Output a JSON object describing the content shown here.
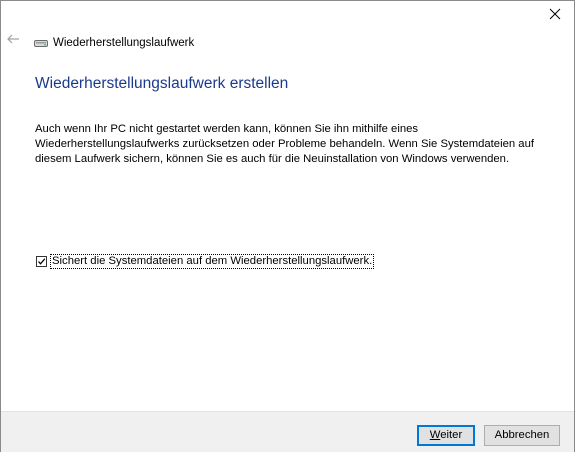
{
  "window": {
    "title": "Wiederherstellungslaufwerk"
  },
  "main": {
    "heading": "Wiederherstellungslaufwerk erstellen",
    "description": "Auch wenn Ihr PC nicht gestartet werden kann, können Sie ihn mithilfe eines Wiederherstellungslaufwerks zurücksetzen oder Probleme behandeln. Wenn Sie Systemdateien auf diesem Laufwerk sichern, können Sie es auch für die Neuinstallation von Windows verwenden.",
    "backup_checkbox": {
      "label": "Sichert die Systemdateien auf dem Wiederherstellungslaufwerk.",
      "checked": true
    }
  },
  "footer": {
    "next_label": "Weiter",
    "cancel_label": "Abbrechen"
  },
  "icons": {
    "close": "close-icon",
    "back": "back-arrow-icon",
    "drive": "drive-icon",
    "check": "checkmark-icon"
  },
  "colors": {
    "heading": "#1a3a8e",
    "default_button_border": "#0078d7",
    "footer_bg": "#f0f0f0"
  }
}
